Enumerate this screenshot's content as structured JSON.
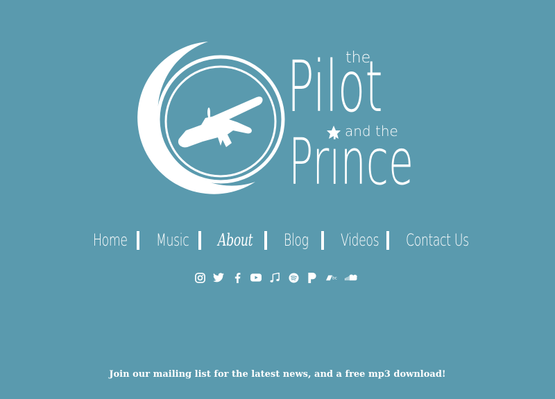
{
  "brand": {
    "word_the_1": "the",
    "word_pilot": "Pilot",
    "word_and_the": "and the",
    "word_prince": "Prince"
  },
  "nav": {
    "items": [
      {
        "label": "Home"
      },
      {
        "label": "Music"
      },
      {
        "label": "About"
      },
      {
        "label": "Blog"
      },
      {
        "label": "Videos"
      },
      {
        "label": "Contact Us"
      }
    ]
  },
  "social": {
    "icons": [
      "instagram-icon",
      "twitter-icon",
      "facebook-icon",
      "youtube-icon",
      "music-note-icon",
      "spotify-icon",
      "pandora-icon",
      "bandcamp-icon",
      "soundcloud-icon"
    ]
  },
  "mailing": {
    "text": "Join our mailing list for the latest news, and a free mp3 download!"
  },
  "colors": {
    "background": "#5a9aae",
    "foreground": "#ffffff"
  }
}
